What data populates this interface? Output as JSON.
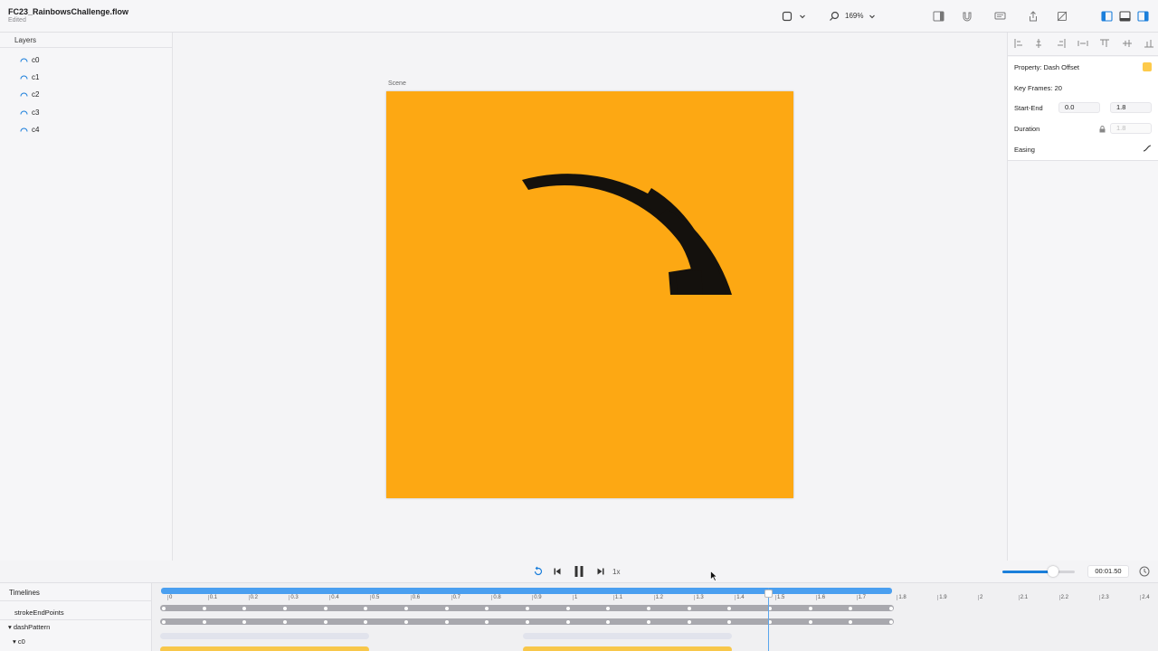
{
  "titlebar": {
    "title": "FC23_RainbowsChallenge.flow",
    "subtitle": "Edited",
    "zoom": "169%"
  },
  "layers": {
    "title": "Layers",
    "items": [
      {
        "label": "c0"
      },
      {
        "label": "c1"
      },
      {
        "label": "c2"
      },
      {
        "label": "c3"
      },
      {
        "label": "c4"
      }
    ]
  },
  "canvas": {
    "scene_label": "Scene",
    "scene_color": "#fda813",
    "arc_color": "#14110d"
  },
  "inspector": {
    "property": "Property: Dash Offset",
    "keyframes": "Key Frames: 20",
    "start_end_label": "Start-End",
    "start_value": "0.0",
    "end_value": "1.8",
    "duration_label": "Duration",
    "duration_value": "1.8",
    "easing_label": "Easing",
    "swatch_color": "#fdca4b"
  },
  "playback": {
    "speed": "1x",
    "time": "00:01.50",
    "volume_fraction": 0.7
  },
  "timelines": {
    "title": "Timelines",
    "rows": [
      {
        "label": "strokeEndPoints"
      },
      {
        "label": "dashPattern"
      },
      {
        "label": "c0"
      }
    ],
    "ticks": [
      "0",
      "0.1",
      "0.2",
      "0.3",
      "0.4",
      "0.5",
      "0.6",
      "0.7",
      "0.8",
      "0.9",
      "1",
      "1.1",
      "1.2",
      "1.3",
      "1.4",
      "1.5",
      "1.6",
      "1.7",
      "1.8",
      "1.9",
      "2",
      "2.1",
      "2.2",
      "2.3",
      "2.4"
    ],
    "playhead_time": 1.5,
    "active_end": 1.8
  }
}
